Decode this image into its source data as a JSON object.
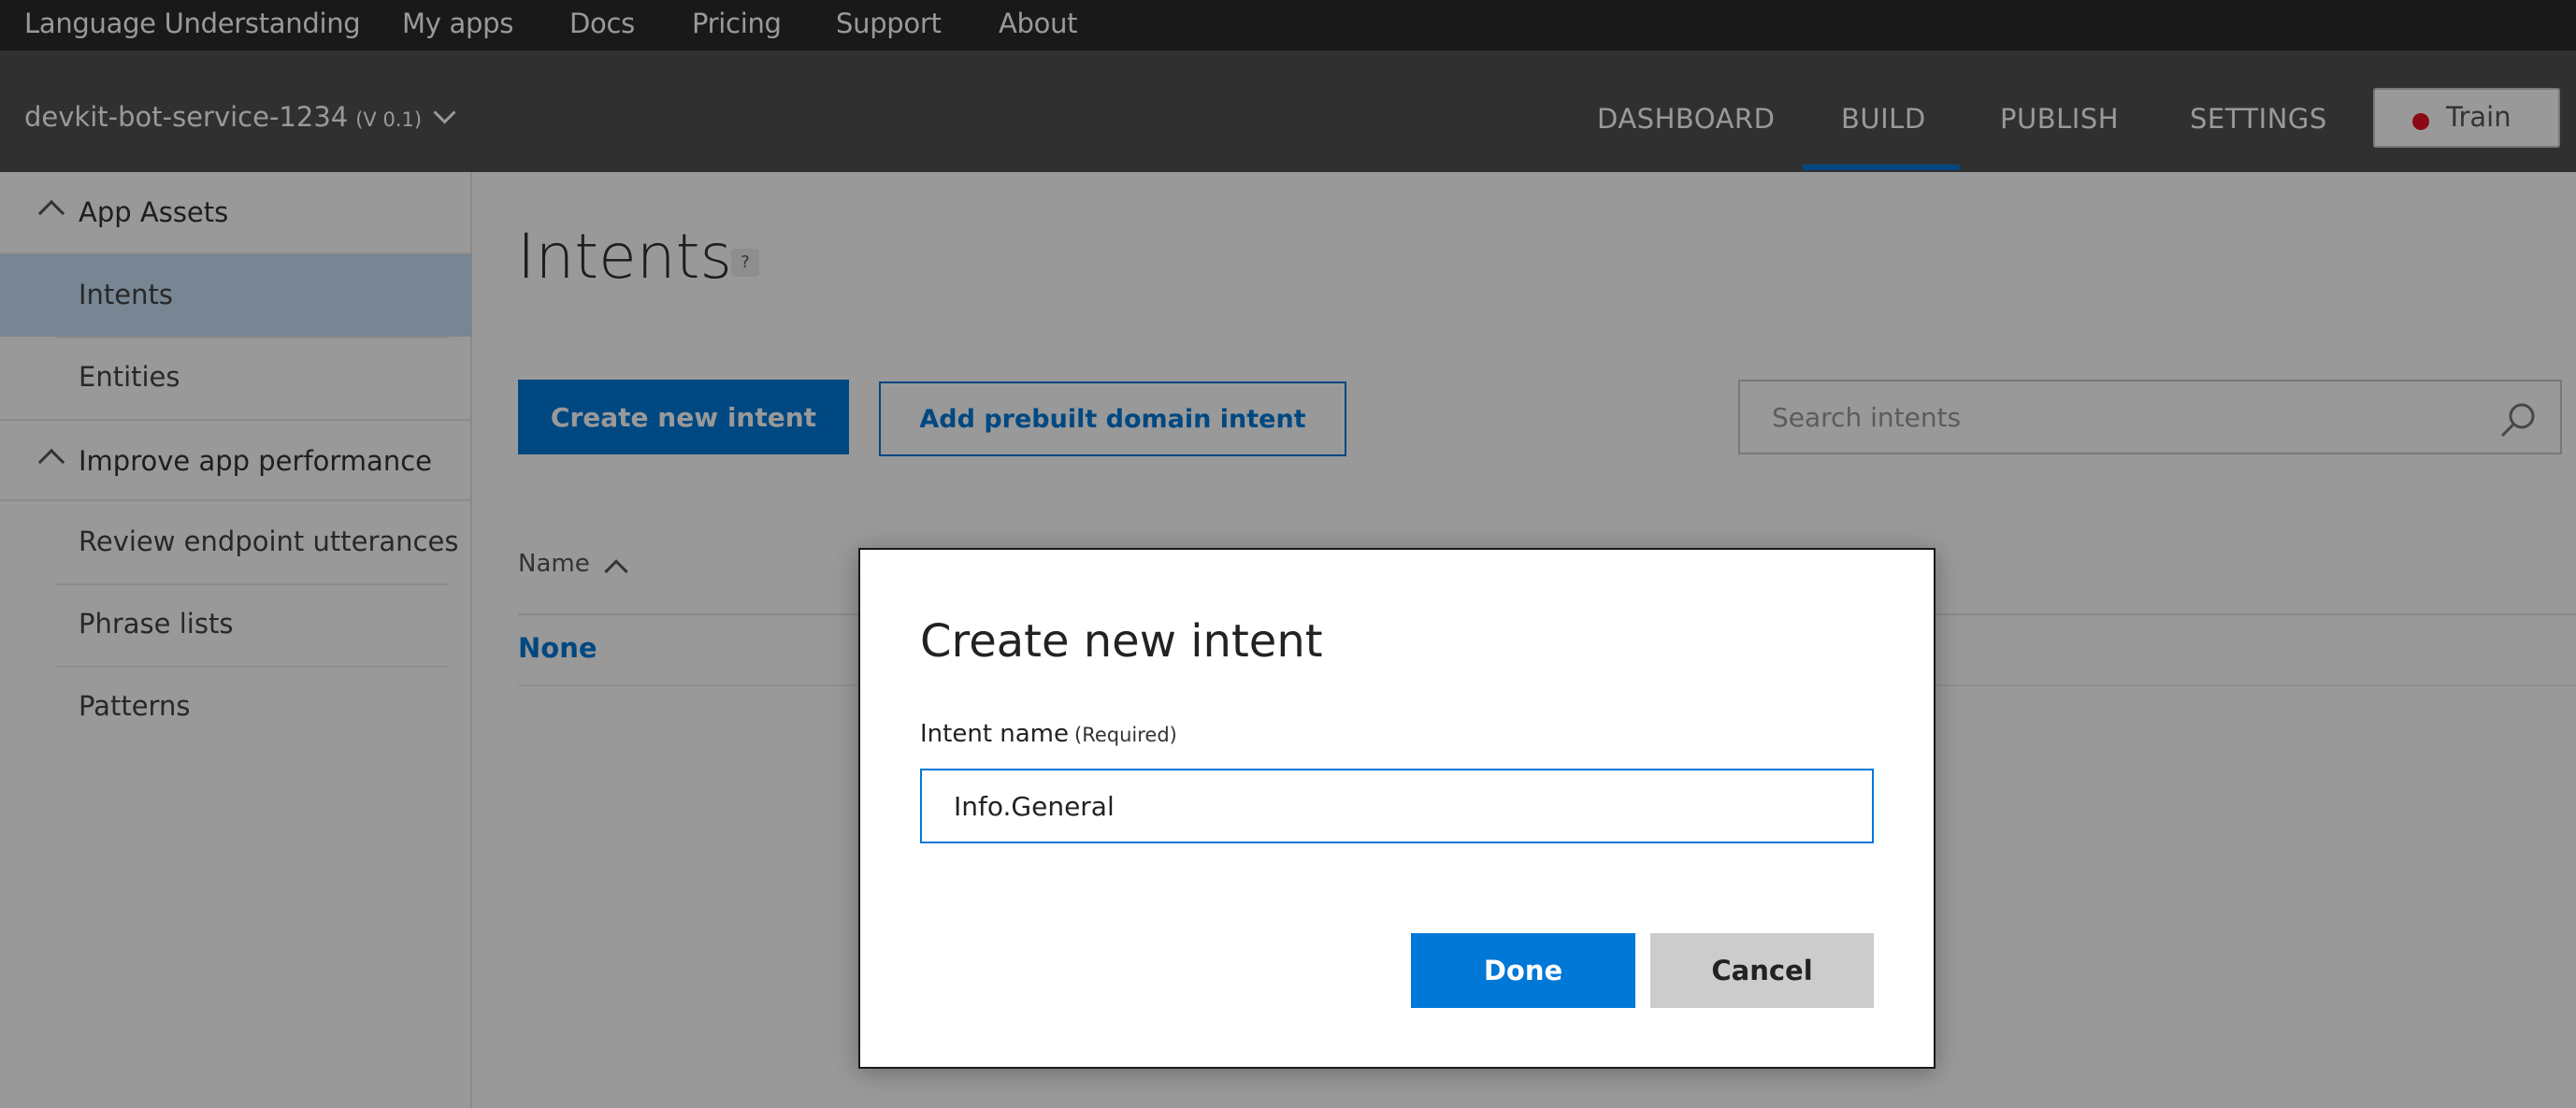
{
  "topnav": {
    "items": [
      "Language Understanding",
      "My apps",
      "Docs",
      "Pricing",
      "Support",
      "About"
    ]
  },
  "appbar": {
    "app_name": "devkit-bot-service-1234",
    "version": "(V 0.1)",
    "tabs": [
      "DASHBOARD",
      "BUILD",
      "PUBLISH",
      "SETTINGS"
    ],
    "active_tab": "BUILD",
    "train_label": "Train"
  },
  "sidebar": {
    "group1": "App Assets",
    "intents": "Intents",
    "entities": "Entities",
    "group2": "Improve app performance",
    "review": "Review endpoint utterances",
    "phrase_lists": "Phrase lists",
    "patterns": "Patterns"
  },
  "main": {
    "title": "Intents",
    "help": "?",
    "create_button": "Create new intent",
    "prebuilt_button": "Add prebuilt domain intent",
    "search_placeholder": "Search intents",
    "column_name": "Name",
    "rows": [
      "None"
    ]
  },
  "modal": {
    "title": "Create new intent",
    "field_label": "Intent name",
    "field_required": "(Required)",
    "field_value": "Info.General",
    "done_label": "Done",
    "cancel_label": "Cancel"
  },
  "colors": {
    "accent": "#0078d7",
    "train_dot": "#e81123",
    "active_item_bg": "#c7e0f4",
    "cancel_bg": "#cccccc"
  }
}
